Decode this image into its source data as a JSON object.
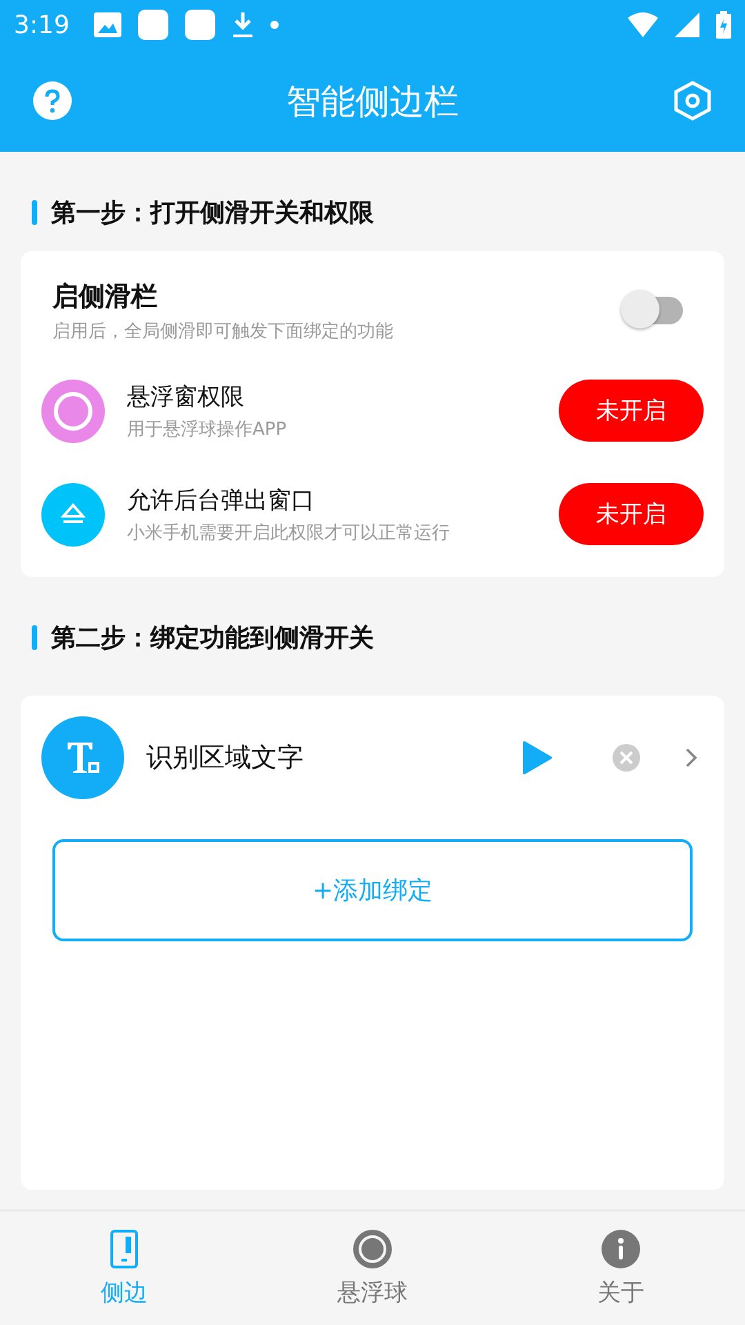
{
  "status_bar": {
    "time": "3:19"
  },
  "app_bar": {
    "title": "智能侧边栏"
  },
  "step1": {
    "heading": "第一步：打开侧滑开关和权限",
    "toggle": {
      "title": "启侧滑栏",
      "subtitle": "启用后，全局侧滑即可触发下面绑定的功能",
      "on": false
    },
    "permissions": [
      {
        "kind": "float",
        "title": "悬浮窗权限",
        "subtitle": "用于悬浮球操作APP",
        "button": "未开启",
        "granted": false
      },
      {
        "kind": "popup",
        "title": "允许后台弹出窗口",
        "subtitle": "小米手机需要开启此权限才可以正常运行",
        "button": "未开启",
        "granted": false
      }
    ]
  },
  "step2": {
    "heading": "第二步：绑定功能到侧滑开关",
    "bindings": [
      {
        "title": "识别区域文字"
      }
    ],
    "add_button": "+添加绑定"
  },
  "bottom_nav": [
    {
      "kind": "side",
      "label": "侧边",
      "selected": true
    },
    {
      "kind": "ball",
      "label": "悬浮球",
      "selected": false
    },
    {
      "kind": "about",
      "label": "关于",
      "selected": false
    }
  ]
}
